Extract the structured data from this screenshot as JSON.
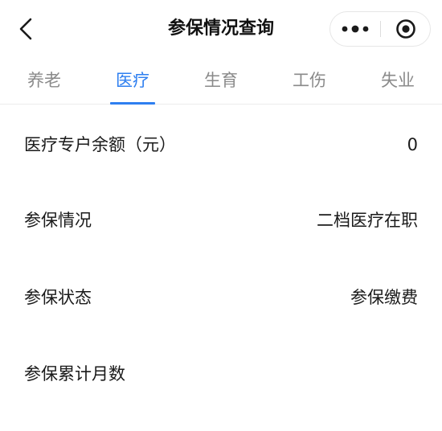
{
  "header": {
    "title": "参保情况查询",
    "back_icon": "chevron-left-icon",
    "more_icon": "more-dots-icon",
    "close_icon": "target-close-icon"
  },
  "tabs": [
    {
      "label": "养老",
      "active": false
    },
    {
      "label": "医疗",
      "active": true
    },
    {
      "label": "生育",
      "active": false
    },
    {
      "label": "工伤",
      "active": false
    },
    {
      "label": "失业",
      "active": false
    }
  ],
  "rows": [
    {
      "label": "医疗专户余额（元）",
      "value": "0"
    },
    {
      "label": "参保情况",
      "value": "二档医疗在职"
    },
    {
      "label": "参保状态",
      "value": "参保缴费"
    },
    {
      "label": "参保累计月数",
      "value": ""
    }
  ],
  "colors": {
    "accent": "#2e7ff0",
    "tab_inactive": "#8a8a8a",
    "text": "#1a1a1a"
  }
}
